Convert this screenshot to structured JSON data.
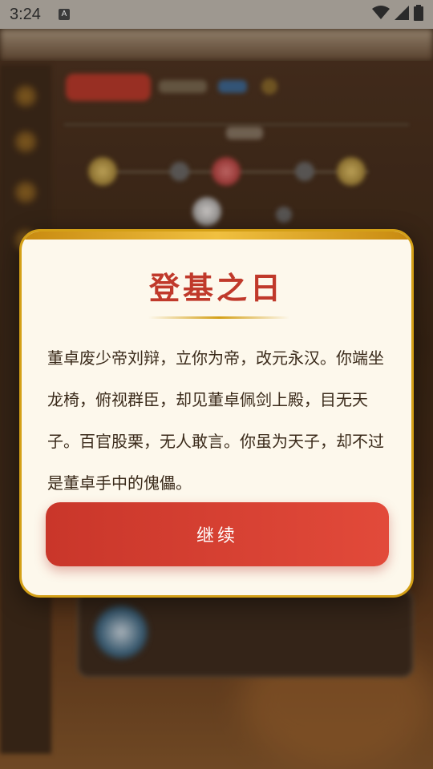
{
  "status_bar": {
    "time": "3:24",
    "notification_icon_letter": "A",
    "icons": [
      "wifi-icon",
      "signal-icon",
      "battery-icon"
    ]
  },
  "dialog": {
    "title": "登基之日",
    "body": "董卓废少帝刘辩，立你为帝，改元永汉。你端坐龙椅，俯视群臣，却见董卓佩剑上殿，目无天子。百官股栗，无人敢言。你虽为天子，却不过是董卓手中的傀儡。",
    "continue_label": "继续"
  },
  "colors": {
    "accent_red": "#c0392b",
    "gold_border": "#d4a017",
    "dialog_bg": "#fdf8ec"
  }
}
